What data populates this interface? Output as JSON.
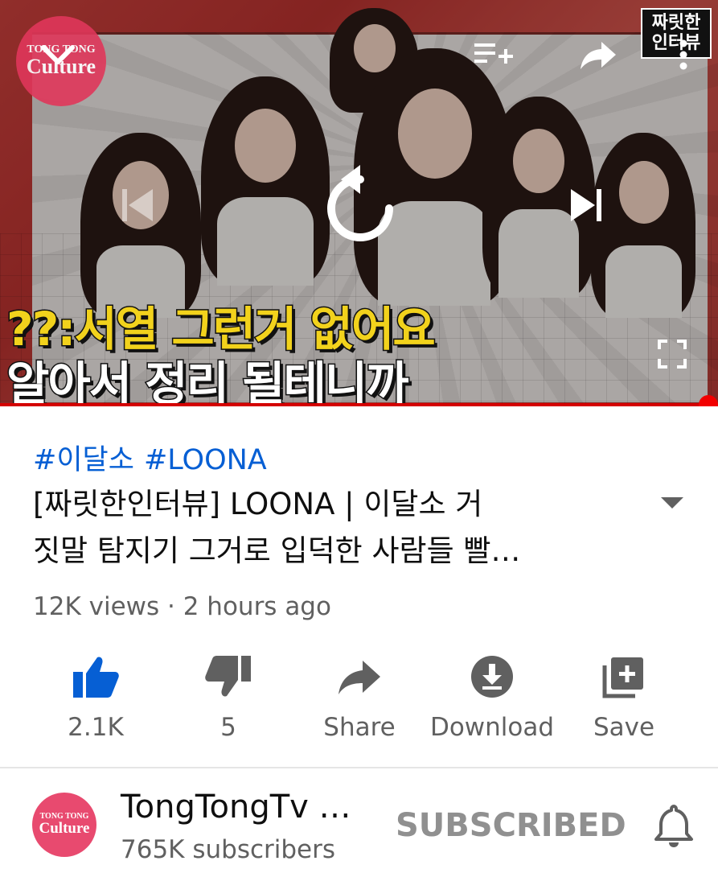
{
  "player": {
    "thumbnail_caption_line1": "??:서열 그런거 없어요",
    "thumbnail_caption_line2": "알아서 정리 될테니까",
    "channel_watermark_small": "TONG TONG",
    "channel_watermark_big": "Culture",
    "series_badge_line1": "짜릿한",
    "series_badge_line2": "인터뷰",
    "progress_fraction": 1.0,
    "icons": {
      "minimize": "chevron-down-icon",
      "add_to_queue": "playlist-add-icon",
      "share": "share-arrow-icon",
      "more": "more-vertical-icon",
      "previous": "skip-previous-icon",
      "replay": "replay-icon",
      "next": "skip-next-icon",
      "fullscreen": "fullscreen-icon"
    }
  },
  "video": {
    "hashtags": [
      "#이달소",
      "#LOONA"
    ],
    "title_line1": "[짜릿한인터뷰] LOONA | 이달소 거",
    "title_line2": "짓말 탐지기 그거로 입덕한 사람들 빨…",
    "meta": "12K views · 2 hours ago"
  },
  "actions": {
    "like": {
      "label": "2.1K",
      "icon": "thumb-up-icon",
      "active_color": "#065fd4"
    },
    "dislike": {
      "label": "5",
      "icon": "thumb-down-icon"
    },
    "share": {
      "label": "Share",
      "icon": "share-icon"
    },
    "download": {
      "label": "Download",
      "icon": "download-icon"
    },
    "save": {
      "label": "Save",
      "icon": "playlist-add-icon"
    }
  },
  "channel": {
    "avatar_small": "TONG TONG",
    "avatar_big": "Culture",
    "name": "TongTongTv …",
    "subscribers": "765K subscribers",
    "subscribe_state": "SUBSCRIBED",
    "bell_icon": "bell-icon"
  },
  "colors": {
    "accent_blue": "#065fd4",
    "progress_red": "#f20000",
    "secondary_text": "#606060",
    "subscribed_text": "#909090"
  }
}
